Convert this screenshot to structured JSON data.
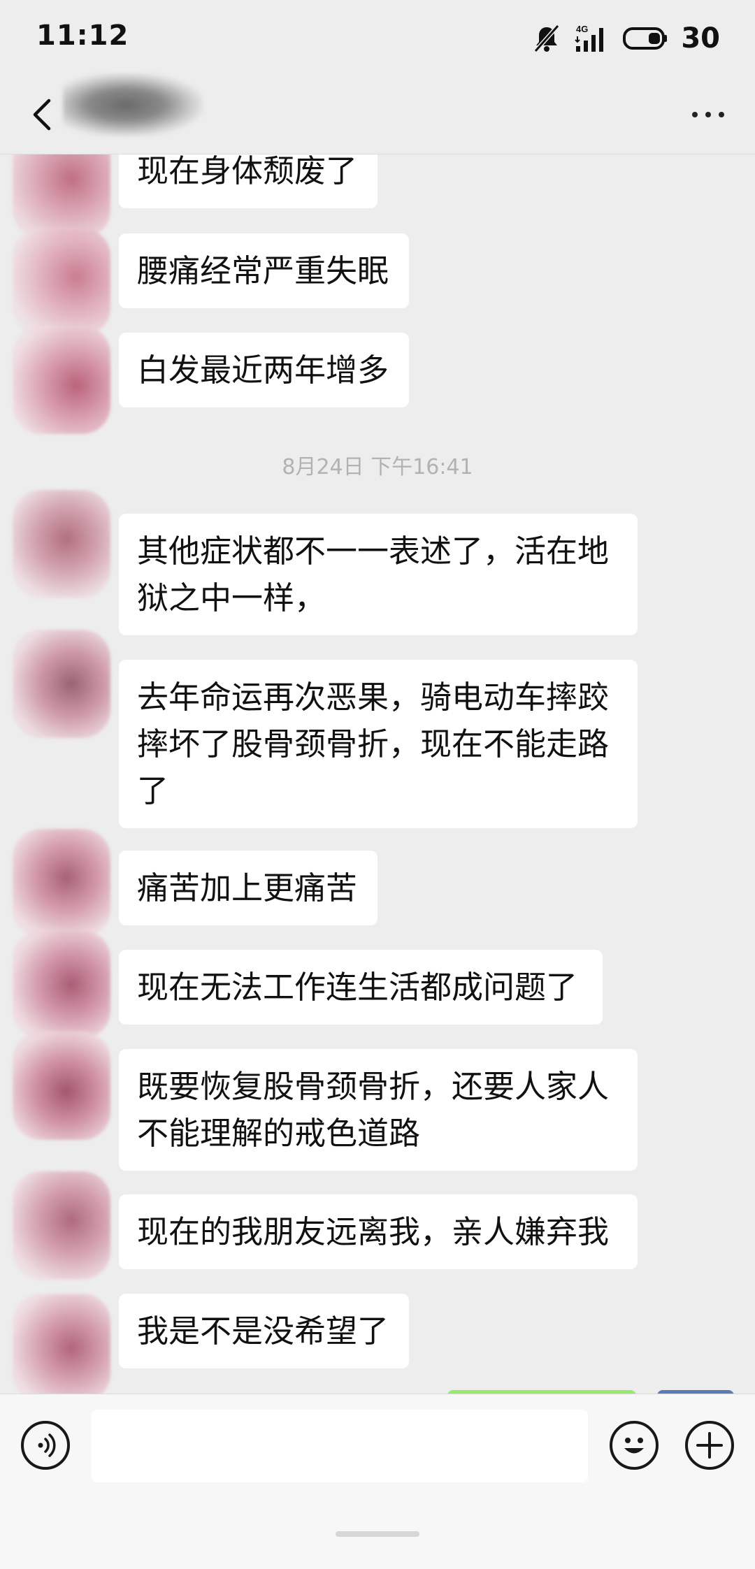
{
  "status_bar": {
    "time": "11:12",
    "network": "4G",
    "battery": "30"
  },
  "header": {
    "back_icon": "chevron-left-icon",
    "more_icon": "more-dots-icon"
  },
  "timestamp": "8月24日 下午16:41",
  "messages": [
    {
      "text": "现在身体颓废了"
    },
    {
      "text": "腰痛经常严重失眠"
    },
    {
      "text": "白发最近两年增多"
    },
    {
      "text": "其他症状都不一一表述了，活在地狱之中一样，"
    },
    {
      "text": "去年命运再次恶果，骑电动车摔跤摔坏了股骨颈骨折，现在不能走路了"
    },
    {
      "text": "痛苦加上更痛苦"
    },
    {
      "text": "现在无法工作连生活都成问题了"
    },
    {
      "text": "既要恢复股骨颈骨折，还要人家人不能理解的戒色道路"
    },
    {
      "text": "现在的我朋友远离我，亲人嫌弃我"
    },
    {
      "text": "我是不是没希望了"
    }
  ],
  "input_bar": {
    "voice_icon": "voice-icon",
    "emoji_icon": "emoji-icon",
    "plus_icon": "plus-icon",
    "input_value": ""
  }
}
